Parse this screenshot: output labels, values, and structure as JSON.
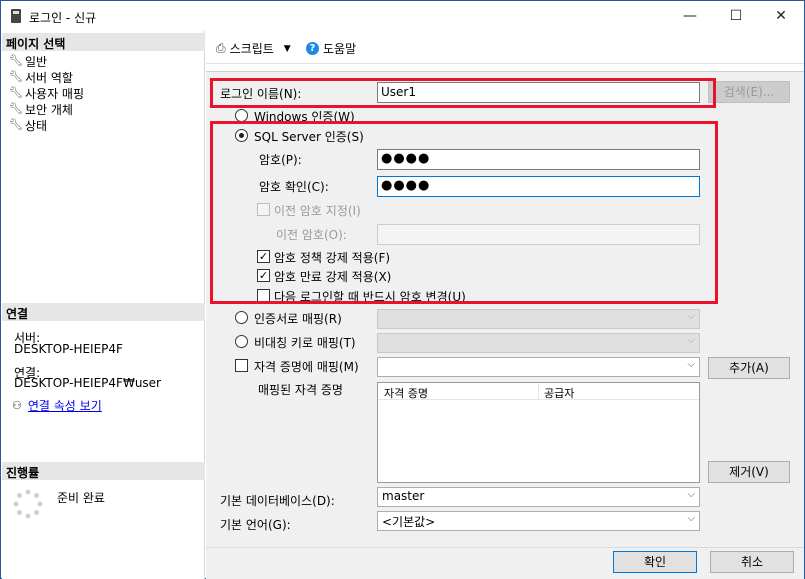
{
  "window": {
    "title": "로그인 - 신규",
    "minimize": "—",
    "maximize": "☐",
    "close": "✕"
  },
  "left": {
    "page_select_header": "페이지 선택",
    "nav": [
      "일반",
      "서버 역할",
      "사용자 매핑",
      "보안 개체",
      "상태"
    ],
    "connection_header": "연결",
    "server_label": "서버:",
    "server_value": "DESKTOP-HEIEP4F",
    "connection_label": "연결:",
    "connection_value": "DESKTOP-HEIEP4F₩user",
    "view_props_link": "연결 속성 보기",
    "progress_header": "진행률",
    "progress_status": "준비 완료"
  },
  "toolbar": {
    "script_label": "스크립트",
    "help_label": "도움말"
  },
  "form": {
    "login_name_label": "로그인 이름(N):",
    "login_name_value": "User1",
    "search_button": "검색(E)...",
    "windows_auth": "Windows 인증(W)",
    "sql_auth": "SQL Server 인증(S)",
    "password_label": "암호(P):",
    "password_value": "●●●●",
    "confirm_label": "암호 확인(C):",
    "confirm_value": "●●●●",
    "specify_old": "이전 암호 지정(I)",
    "old_password_label": "이전 암호(O):",
    "enforce_policy": "암호 정책 강제 적용(F)",
    "enforce_expiration": "암호 만료 강제 적용(X)",
    "must_change": "다음 로그인할 때 반드시 암호 변경(U)",
    "cert_mapping": "인증서로 매핑(R)",
    "asym_key_mapping": "비대칭 키로 매핑(T)",
    "credential_mapping": "자격 증명에 매핑(M)",
    "add_button": "추가(A)",
    "mapped_credentials_label": "매핑된 자격 증명",
    "cred_col_credential": "자격 증명",
    "cred_col_provider": "공급자",
    "remove_button": "제거(V)",
    "default_db_label": "기본 데이터베이스(D):",
    "default_db_value": "master",
    "default_lang_label": "기본 언어(G):",
    "default_lang_value": "<기본값>"
  },
  "footer": {
    "ok_button": "확인",
    "cancel_button": "취소"
  },
  "colors": {
    "highlight_border": "#e8142c",
    "link": "#0000ee",
    "focus": "#0078d7"
  }
}
